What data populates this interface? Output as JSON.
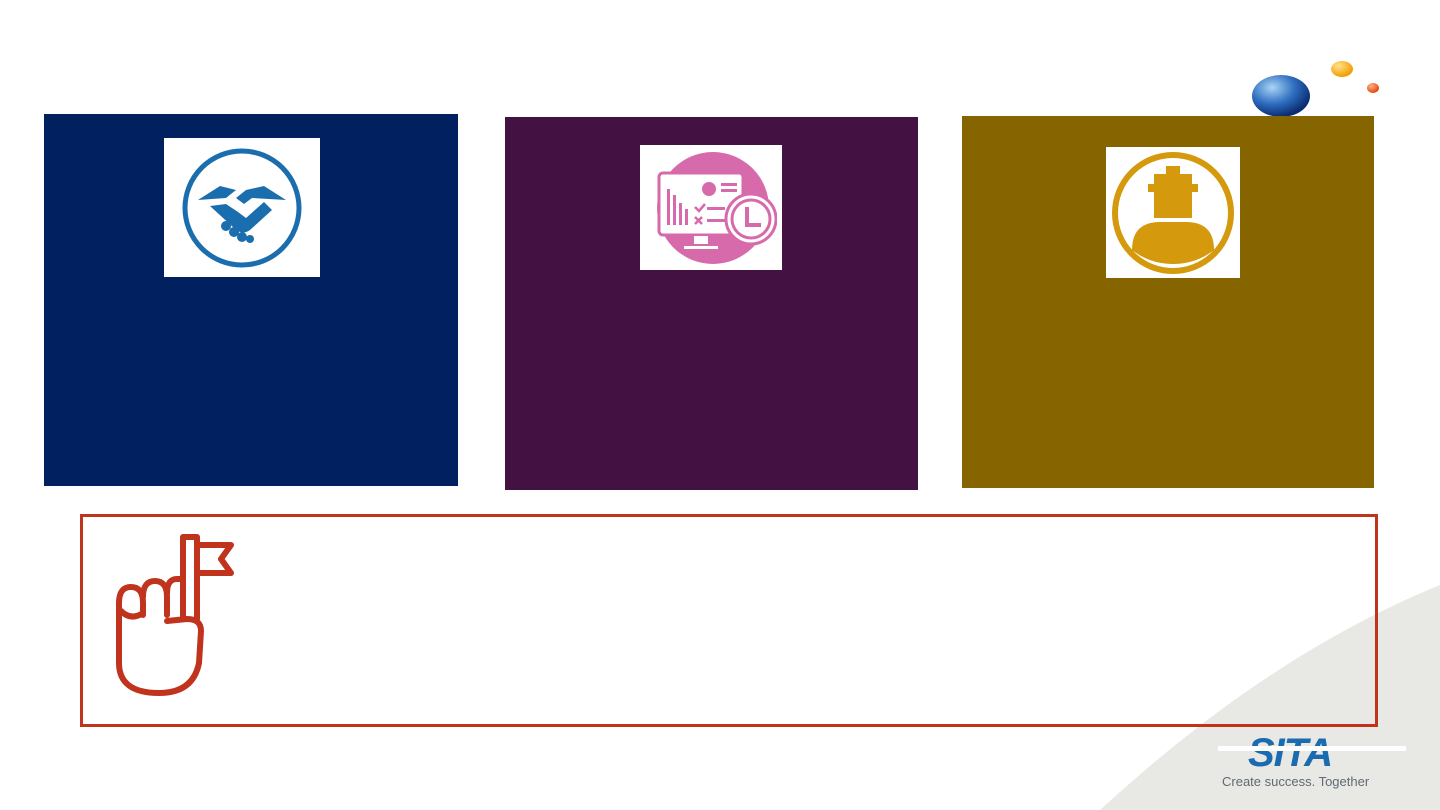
{
  "slide": {
    "cards": [
      {
        "icon": "handshake-icon",
        "color": "#00205f",
        "icon_color": "#1a6ead"
      },
      {
        "icon": "dashboard-clock-icon",
        "color": "#431242",
        "icon_color": "#d76aab"
      },
      {
        "icon": "person-icon",
        "color": "#866500",
        "icon_color": "#d4990d"
      }
    ],
    "note": {
      "icon": "reminder-finger-icon",
      "border_color": "#c0341d"
    },
    "brand": {
      "logo": "SITA",
      "tagline": "Create success. Together",
      "logo_color": "#1a6bb0"
    }
  }
}
